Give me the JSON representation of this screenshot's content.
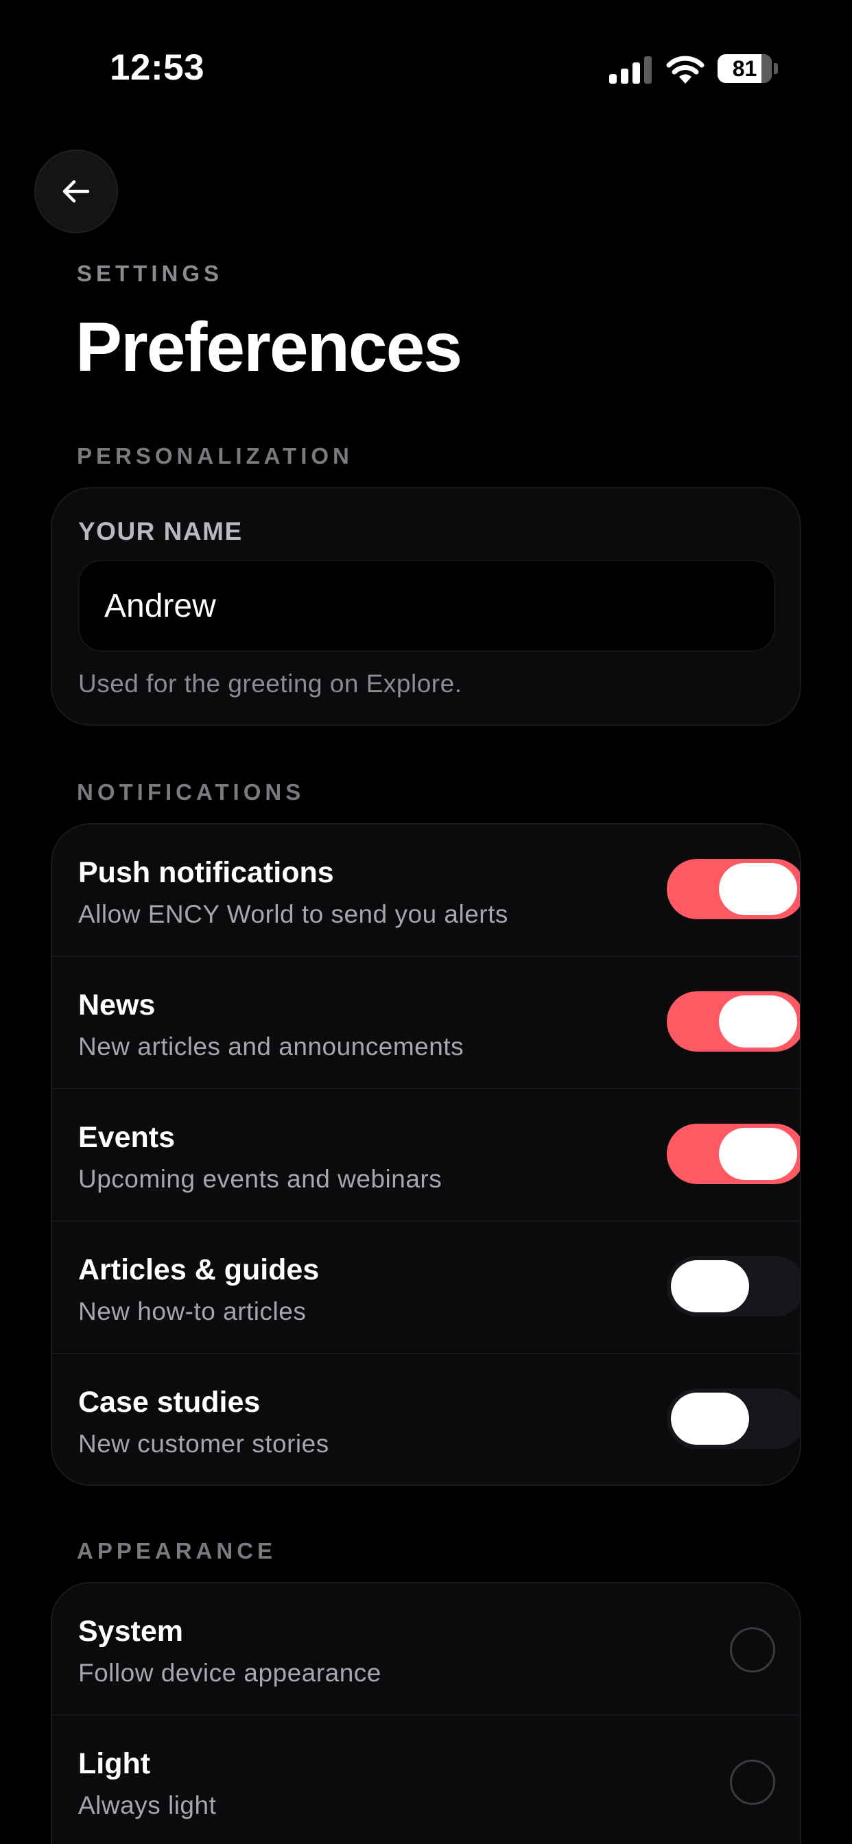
{
  "status_bar": {
    "time": "12:53",
    "battery_level": "81",
    "battery_fraction": 0.81,
    "icons": [
      "signal-icon",
      "wifi-icon",
      "battery-icon"
    ]
  },
  "header": {
    "back_icon": "arrow-left-icon",
    "eyebrow": "SETTINGS",
    "title": "Preferences"
  },
  "personalization": {
    "section_label": "PERSONALIZATION",
    "field_label": "YOUR NAME",
    "name_value": "Andrew",
    "hint": "Used for the greeting on Explore."
  },
  "notifications": {
    "section_label": "NOTIFICATIONS",
    "items": [
      {
        "title": "Push notifications",
        "subtitle": "Allow ENCY World to send you alerts",
        "enabled": true
      },
      {
        "title": "News",
        "subtitle": "New articles and announcements",
        "enabled": true
      },
      {
        "title": "Events",
        "subtitle": "Upcoming events and webinars",
        "enabled": true
      },
      {
        "title": "Articles & guides",
        "subtitle": "New how-to articles",
        "enabled": false
      },
      {
        "title": "Case studies",
        "subtitle": "New customer stories",
        "enabled": false
      }
    ]
  },
  "appearance": {
    "section_label": "APPEARANCE",
    "options": [
      {
        "title": "System",
        "subtitle": "Follow device appearance",
        "selected": false
      },
      {
        "title": "Light",
        "subtitle": "Always light",
        "selected": false
      }
    ]
  },
  "colors": {
    "accent": "#ff5a64",
    "background": "#000000",
    "card": "#0b0b0e",
    "toggle_off": "#16161b"
  }
}
